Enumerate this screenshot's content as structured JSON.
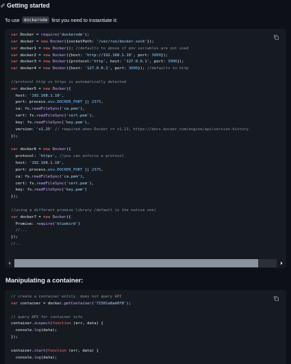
{
  "section1": {
    "heading": "Getting started",
    "intro_before": "To use",
    "intro_code": "dockerode",
    "intro_after": "first you need to instantiate it:"
  },
  "code1": {
    "lines": [
      [
        [
          "kw",
          "var"
        ],
        [
          "pl",
          " Docker = "
        ],
        [
          "fn",
          "require"
        ],
        [
          "pl",
          "("
        ],
        [
          "str",
          "'dockerode'"
        ],
        [
          "pl",
          ");"
        ]
      ],
      [
        [
          "kw",
          "var"
        ],
        [
          "pl",
          " docker = "
        ],
        [
          "kw",
          "new"
        ],
        [
          "pl",
          " "
        ],
        [
          "fn",
          "Docker"
        ],
        [
          "pl",
          "({socketPath: "
        ],
        [
          "str",
          "'/var/run/docker.sock'"
        ],
        [
          "pl",
          "});"
        ]
      ],
      [
        [
          "kw",
          "var"
        ],
        [
          "pl",
          " docker1 = "
        ],
        [
          "kw",
          "new"
        ],
        [
          "pl",
          " "
        ],
        [
          "fn",
          "Docker"
        ],
        [
          "pl",
          "(); "
        ],
        [
          "cm",
          "//defaults to above if env variables are not used"
        ]
      ],
      [
        [
          "kw",
          "var"
        ],
        [
          "pl",
          " docker2 = "
        ],
        [
          "kw",
          "new"
        ],
        [
          "pl",
          " "
        ],
        [
          "fn",
          "Docker"
        ],
        [
          "pl",
          "({host: "
        ],
        [
          "str",
          "'http://192.168.1.10'"
        ],
        [
          "pl",
          ", port: "
        ],
        [
          "num",
          "3000"
        ],
        [
          "pl",
          "});"
        ]
      ],
      [
        [
          "kw",
          "var"
        ],
        [
          "pl",
          " docker3 = "
        ],
        [
          "kw",
          "new"
        ],
        [
          "pl",
          " "
        ],
        [
          "fn",
          "Docker"
        ],
        [
          "pl",
          "({protocol:"
        ],
        [
          "str",
          "'http'"
        ],
        [
          "pl",
          ", host: "
        ],
        [
          "str",
          "'127.0.0.1'"
        ],
        [
          "pl",
          ", port: "
        ],
        [
          "num",
          "3000"
        ],
        [
          "pl",
          "});"
        ]
      ],
      [
        [
          "kw",
          "var"
        ],
        [
          "pl",
          " docker4 = "
        ],
        [
          "kw",
          "new"
        ],
        [
          "pl",
          " "
        ],
        [
          "fn",
          "Docker"
        ],
        [
          "pl",
          "({host: "
        ],
        [
          "str",
          "'127.0.0.1'"
        ],
        [
          "pl",
          ", port: "
        ],
        [
          "num",
          "3000"
        ],
        [
          "pl",
          "}); "
        ],
        [
          "cm",
          "//defaults to http"
        ]
      ],
      [],
      [
        [
          "cm",
          "//protocol http vs https is automatically detected"
        ]
      ],
      [
        [
          "kw",
          "var"
        ],
        [
          "pl",
          " docker5 = "
        ],
        [
          "kw",
          "new"
        ],
        [
          "pl",
          " "
        ],
        [
          "fn",
          "Docker"
        ],
        [
          "pl",
          "({"
        ]
      ],
      [
        [
          "pl",
          "  host: "
        ],
        [
          "str",
          "'192.168.1.10'"
        ],
        [
          "pl",
          ","
        ]
      ],
      [
        [
          "pl",
          "  port: process."
        ],
        [
          "num",
          "env"
        ],
        [
          "pl",
          "."
        ],
        [
          "num",
          "DOCKER_PORT"
        ],
        [
          "pl",
          " || "
        ],
        [
          "num",
          "2375"
        ],
        [
          "pl",
          ","
        ]
      ],
      [
        [
          "pl",
          "  ca: fs."
        ],
        [
          "fn",
          "readFileSync"
        ],
        [
          "pl",
          "("
        ],
        [
          "str",
          "'ca.pem'"
        ],
        [
          "pl",
          "),"
        ]
      ],
      [
        [
          "pl",
          "  cert: fs."
        ],
        [
          "fn",
          "readFileSync"
        ],
        [
          "pl",
          "("
        ],
        [
          "str",
          "'cert.pem'"
        ],
        [
          "pl",
          "),"
        ]
      ],
      [
        [
          "pl",
          "  key: fs."
        ],
        [
          "fn",
          "readFileSync"
        ],
        [
          "pl",
          "("
        ],
        [
          "str",
          "'key.pem'"
        ],
        [
          "pl",
          "),"
        ]
      ],
      [
        [
          "pl",
          "  version: "
        ],
        [
          "str",
          "'v1.25'"
        ],
        [
          "pl",
          " "
        ],
        [
          "cm",
          "// required when Docker >= v1.13, https://docs.docker.com/engine/api/version-history"
        ]
      ],
      [
        [
          "pl",
          "});"
        ]
      ],
      [],
      [
        [
          "kw",
          "var"
        ],
        [
          "pl",
          " docker6 = "
        ],
        [
          "kw",
          "new"
        ],
        [
          "pl",
          " "
        ],
        [
          "fn",
          "Docker"
        ],
        [
          "pl",
          "({"
        ]
      ],
      [
        [
          "pl",
          "  protocol: "
        ],
        [
          "str",
          "'https'"
        ],
        [
          "pl",
          ", "
        ],
        [
          "cm",
          "//you can enforce a protocol"
        ]
      ],
      [
        [
          "pl",
          "  host: "
        ],
        [
          "str",
          "'192.168.1.10'"
        ],
        [
          "pl",
          ","
        ]
      ],
      [
        [
          "pl",
          "  port: process."
        ],
        [
          "num",
          "env"
        ],
        [
          "pl",
          "."
        ],
        [
          "num",
          "DOCKER_PORT"
        ],
        [
          "pl",
          " || "
        ],
        [
          "num",
          "2375"
        ],
        [
          "pl",
          ","
        ]
      ],
      [
        [
          "pl",
          "  ca: fs."
        ],
        [
          "fn",
          "readFileSync"
        ],
        [
          "pl",
          "("
        ],
        [
          "str",
          "'ca.pem'"
        ],
        [
          "pl",
          "),"
        ]
      ],
      [
        [
          "pl",
          "  cert: fs."
        ],
        [
          "fn",
          "readFileSync"
        ],
        [
          "pl",
          "("
        ],
        [
          "str",
          "'cert.pem'"
        ],
        [
          "pl",
          "),"
        ]
      ],
      [
        [
          "pl",
          "  key: fs."
        ],
        [
          "fn",
          "readFileSync"
        ],
        [
          "pl",
          "("
        ],
        [
          "str",
          "'key.pem'"
        ],
        [
          "pl",
          ")"
        ]
      ],
      [
        [
          "pl",
          "});"
        ]
      ],
      [],
      [
        [
          "cm",
          "//using a different promise library (default is the native one)"
        ]
      ],
      [
        [
          "kw",
          "var"
        ],
        [
          "pl",
          " docker7 = "
        ],
        [
          "kw",
          "new"
        ],
        [
          "pl",
          " "
        ],
        [
          "fn",
          "Docker"
        ],
        [
          "pl",
          "({"
        ]
      ],
      [
        [
          "pl",
          "  Promise: "
        ],
        [
          "fn",
          "require"
        ],
        [
          "pl",
          "("
        ],
        [
          "str",
          "'bluebird'"
        ],
        [
          "pl",
          ")"
        ]
      ],
      [
        [
          "pl",
          "  "
        ],
        [
          "cm",
          "//..."
        ]
      ],
      [
        [
          "pl",
          "});"
        ]
      ],
      [
        [
          "cm",
          "//..."
        ]
      ]
    ]
  },
  "scroll": {
    "position": 0,
    "visible_fraction": 0.93
  },
  "section2": {
    "heading": "Manipulating a container:"
  },
  "code2": {
    "lines": [
      [
        [
          "cm",
          "// create a container entity. does not query API"
        ]
      ],
      [
        [
          "kw",
          "var"
        ],
        [
          "pl",
          " container = docker."
        ],
        [
          "fn",
          "getContainer"
        ],
        [
          "pl",
          "("
        ],
        [
          "str",
          "'71501a8ab0f8'"
        ],
        [
          "pl",
          ");"
        ]
      ],
      [],
      [
        [
          "cm",
          "// query API for container info"
        ]
      ],
      [
        [
          "pl",
          "container."
        ],
        [
          "fn",
          "inspect"
        ],
        [
          "pl",
          "("
        ],
        [
          "kw",
          "function"
        ],
        [
          "pl",
          " (err, data) {"
        ]
      ],
      [
        [
          "pl",
          "  console."
        ],
        [
          "fn",
          "log"
        ],
        [
          "pl",
          "(data);"
        ]
      ],
      [
        [
          "pl",
          "});"
        ]
      ],
      [],
      [
        [
          "pl",
          "container."
        ],
        [
          "fn",
          "start"
        ],
        [
          "pl",
          "("
        ],
        [
          "kw",
          "function"
        ],
        [
          "pl",
          " (err, data) {"
        ]
      ],
      [
        [
          "pl",
          "  console."
        ],
        [
          "fn",
          "log"
        ],
        [
          "pl",
          "(data);"
        ]
      ]
    ]
  },
  "colors": {
    "background": "#0d1117",
    "code_background": "#161b22",
    "keyword": "#ff7b72",
    "string": "#a5d6ff",
    "comment": "#8b949e",
    "function": "#d2a8ff",
    "constant": "#79c0ff"
  },
  "icons": [
    "link-icon",
    "copy-icon",
    "chevron-left-icon",
    "chevron-right-icon"
  ]
}
